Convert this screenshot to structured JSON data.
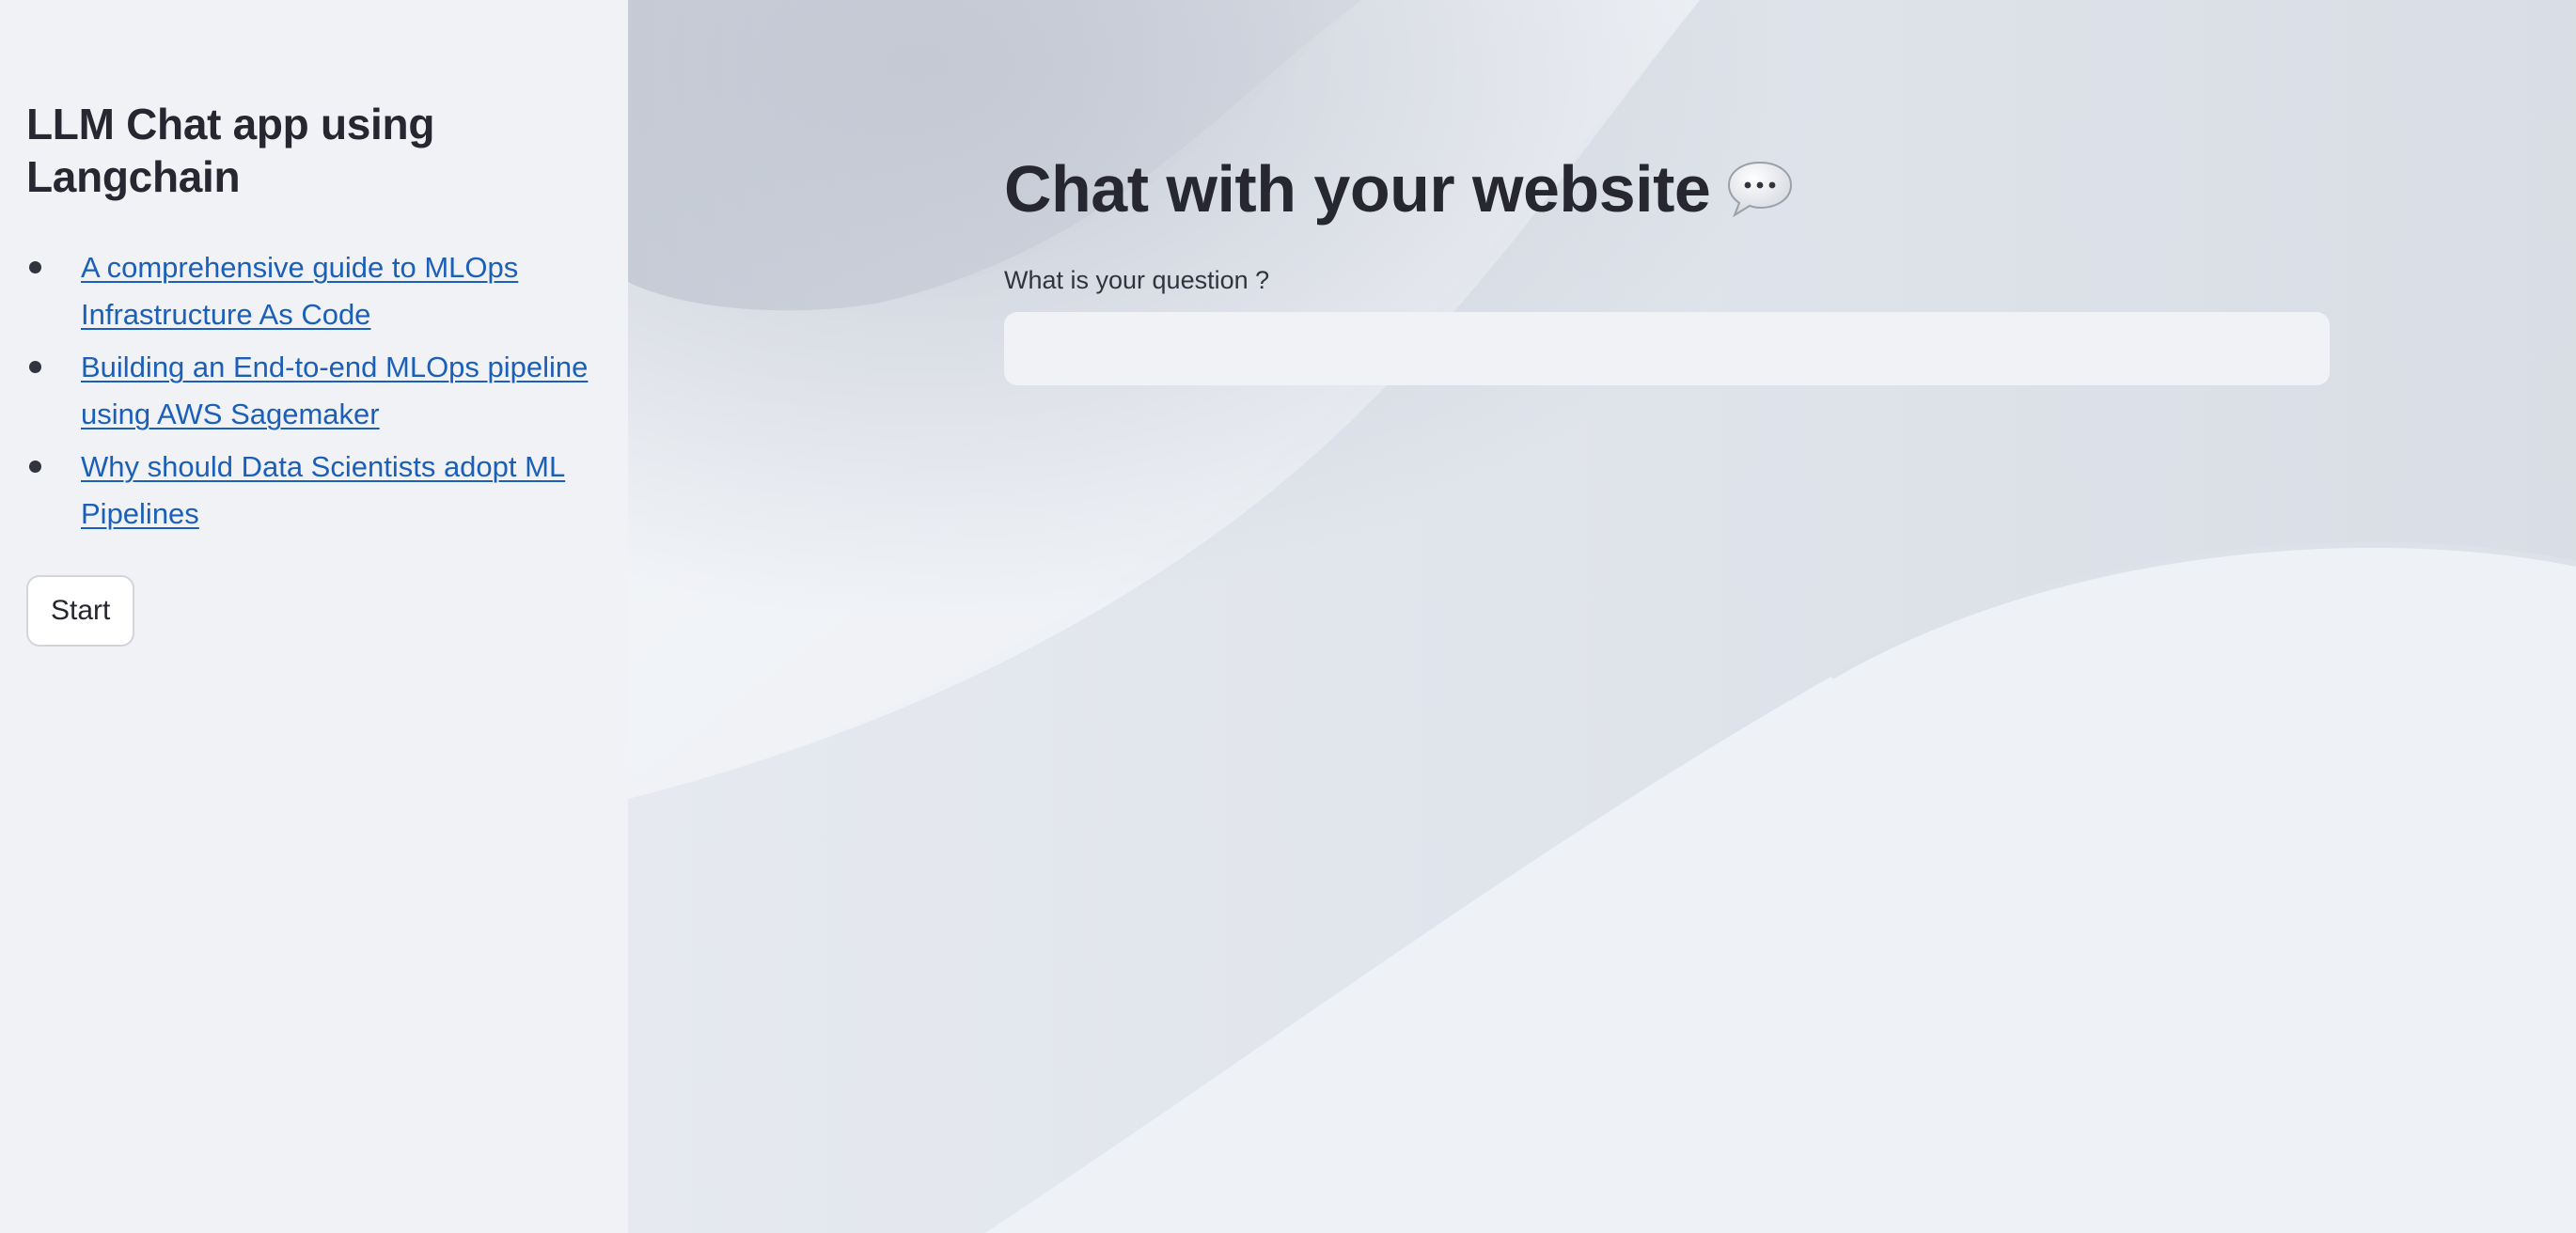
{
  "sidebar": {
    "title": "LLM Chat app using Langchain",
    "links": [
      {
        "label": "A comprehensive guide to MLOps Infrastructure As Code"
      },
      {
        "label": "Building an End-to-end MLOps pipeline using AWS Sagemaker"
      },
      {
        "label": "Why should Data Scientists adopt ML Pipelines"
      }
    ],
    "start_label": "Start"
  },
  "main": {
    "title": "Chat with your website",
    "title_icon": "speech-balloon-icon",
    "question_label": "What is your question ?",
    "question_value": ""
  },
  "colors": {
    "sidebar_bg": "#f0f2f6",
    "link": "#1c5fb8",
    "text": "#262730"
  }
}
